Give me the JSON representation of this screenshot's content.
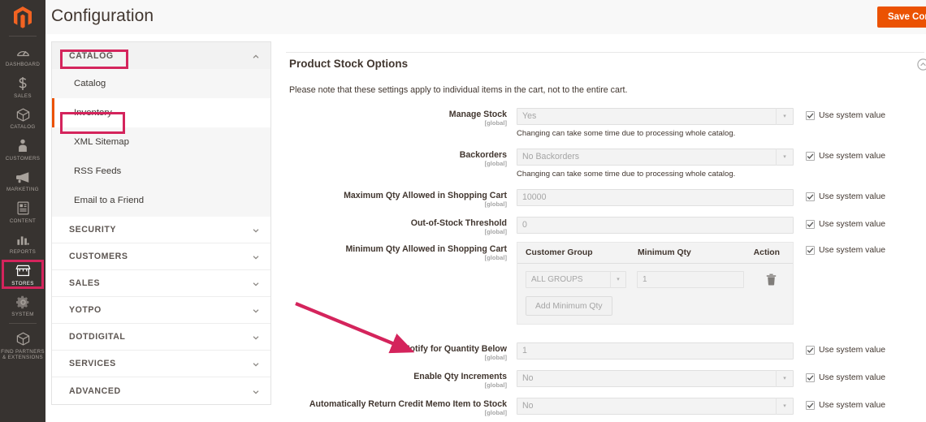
{
  "header": {
    "title": "Configuration",
    "save_label": "Save Config"
  },
  "colors": {
    "brand_orange": "#eb5202",
    "annotation_red": "#d4245c",
    "rail_bg": "#373330"
  },
  "rail": {
    "logo_icon": "magento-logo-icon",
    "items": [
      {
        "label": "Dashboard",
        "icon": "dashboard-icon",
        "active": false
      },
      {
        "label": "Sales",
        "icon": "dollar-icon",
        "active": false
      },
      {
        "label": "Catalog",
        "icon": "box-icon",
        "active": false
      },
      {
        "label": "Customers",
        "icon": "person-icon",
        "active": false
      },
      {
        "label": "Marketing",
        "icon": "megaphone-icon",
        "active": false
      },
      {
        "label": "Content",
        "icon": "page-icon",
        "active": false
      },
      {
        "label": "Reports",
        "icon": "bar-chart-icon",
        "active": false
      },
      {
        "label": "Stores",
        "icon": "store-icon",
        "active": true
      },
      {
        "label": "System",
        "icon": "gear-icon",
        "active": false
      },
      {
        "label": "Find Partners & Extensions",
        "icon": "cube-icon",
        "active": false
      }
    ]
  },
  "config_nav": {
    "catalog_section": {
      "label": "Catalog",
      "expanded": true,
      "chevron": "chevron-up-icon",
      "items": [
        {
          "label": "Catalog",
          "current": false
        },
        {
          "label": "Inventory",
          "current": true
        },
        {
          "label": "XML Sitemap",
          "current": false
        },
        {
          "label": "RSS Feeds",
          "current": false
        },
        {
          "label": "Email to a Friend",
          "current": false
        }
      ]
    },
    "sections": [
      {
        "label": "Security",
        "chevron": "chevron-down-icon"
      },
      {
        "label": "Customers",
        "chevron": "chevron-down-icon"
      },
      {
        "label": "Sales",
        "chevron": "chevron-down-icon"
      },
      {
        "label": "Yotpo",
        "chevron": "chevron-down-icon"
      },
      {
        "label": "Dotdigital",
        "chevron": "chevron-down-icon"
      },
      {
        "label": "Services",
        "chevron": "chevron-down-icon"
      },
      {
        "label": "Advanced",
        "chevron": "chevron-down-icon"
      }
    ]
  },
  "settings": {
    "section_title": "Product Stock Options",
    "section_note": "Please note that these settings apply to individual items in the cart, not to the entire cart.",
    "collapse_icon": "chevron-collapse-icon",
    "scope_tag": "[global]",
    "use_system_value_label": "Use system value",
    "fields": {
      "manage_stock": {
        "label": "Manage Stock",
        "value": "Yes",
        "hint": "Changing can take some time due to processing whole catalog.",
        "use_system_value": true
      },
      "backorders": {
        "label": "Backorders",
        "value": "No Backorders",
        "hint": "Changing can take some time due to processing whole catalog.",
        "use_system_value": true
      },
      "max_qty_cart": {
        "label": "Maximum Qty Allowed in Shopping Cart",
        "value": "10000",
        "use_system_value": true
      },
      "out_of_stock_threshold": {
        "label": "Out-of-Stock Threshold",
        "value": "0",
        "use_system_value": true
      },
      "min_qty_cart": {
        "label": "Minimum Qty Allowed in Shopping Cart",
        "use_system_value": true,
        "table": {
          "columns": [
            "Customer Group",
            "Minimum Qty",
            "Action"
          ],
          "rows": [
            {
              "customer_group": "ALL GROUPS",
              "minimum_qty": "1",
              "action_icon": "trash-icon"
            }
          ],
          "add_label": "Add Minimum Qty"
        }
      },
      "notify_qty_below": {
        "label": "Notify for Quantity Below",
        "value": "1",
        "use_system_value": true
      },
      "enable_qty_increments": {
        "label": "Enable Qty Increments",
        "value": "No",
        "use_system_value": true
      },
      "auto_return_credit_memo": {
        "label": "Automatically Return Credit Memo Item to Stock",
        "value": "No",
        "use_system_value": true
      }
    }
  },
  "annotations": {
    "arrow": {
      "target": "Notify for Quantity Below",
      "color": "#d4245c"
    },
    "boxes": [
      {
        "target": "Catalog section header"
      },
      {
        "target": "Inventory nav item"
      },
      {
        "target": "Stores rail item"
      }
    ]
  }
}
